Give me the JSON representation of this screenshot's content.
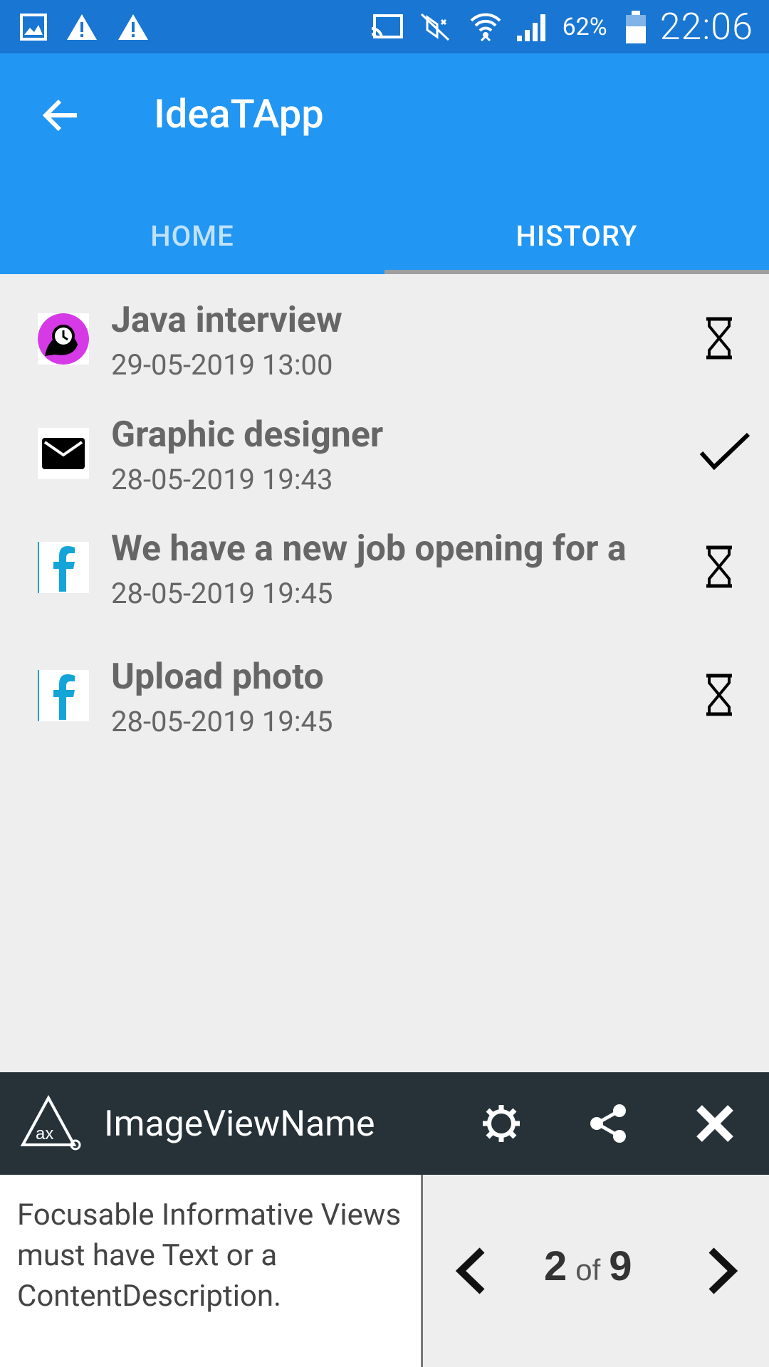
{
  "status_bar": {
    "battery": "62%",
    "time": "22:06",
    "icons": [
      "image-icon",
      "warning-icon",
      "warning-icon",
      "cast-icon",
      "mute-icon",
      "wifi-icon",
      "signal-icon",
      "battery-icon"
    ]
  },
  "app_bar": {
    "title": "IdeaTApp",
    "tabs": [
      {
        "label": "HOME",
        "active": false
      },
      {
        "label": "HISTORY",
        "active": true
      }
    ]
  },
  "history": [
    {
      "title": "Java interview",
      "date": "29-05-2019 13:00",
      "icon": "clock-chat-icon",
      "status": "pending"
    },
    {
      "title": "Graphic designer",
      "date": "28-05-2019 19:43",
      "icon": "mail-icon",
      "status": "done"
    },
    {
      "title": "We have a new job opening for a",
      "date": "28-05-2019 19:45",
      "icon": "facebook-icon",
      "status": "pending"
    },
    {
      "title": "Upload photo",
      "date": "28-05-2019 19:45",
      "icon": "facebook-icon",
      "status": "pending"
    }
  ],
  "scanner": {
    "title": "ImageViewName",
    "message": "Focusable Informative Views must have Text or a ContentDescription.",
    "current": "2",
    "of_label": "of",
    "total": "9",
    "colors": {
      "toolbar": "#263238",
      "appbar": "#2196f3",
      "statusbar": "#1976d2"
    }
  }
}
